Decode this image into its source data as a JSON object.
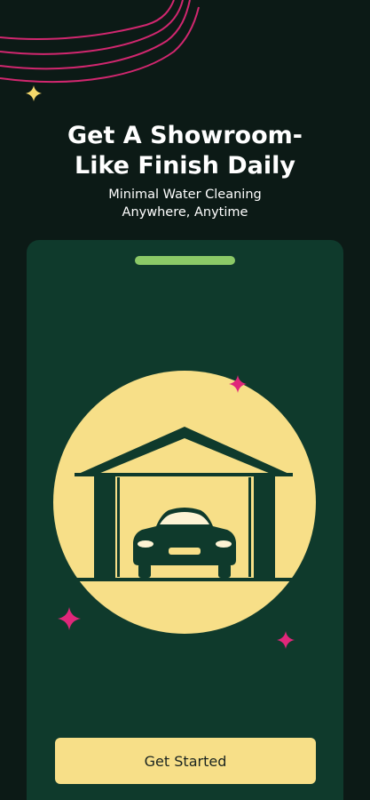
{
  "hero": {
    "title_line1": "Get A Showroom-",
    "title_line2": "Like Finish Daily",
    "subtitle_line1": "Minimal Water Cleaning",
    "subtitle_line2": "Anywhere, Anytime"
  },
  "illustration": {
    "icon": "car-garage-icon"
  },
  "cta": {
    "label": "Get Started"
  },
  "colors": {
    "background": "#0c1a16",
    "card": "#0f3a2c",
    "accent_yellow": "#f7df88",
    "accent_green": "#8bc967",
    "accent_pink": "#e0277a"
  }
}
